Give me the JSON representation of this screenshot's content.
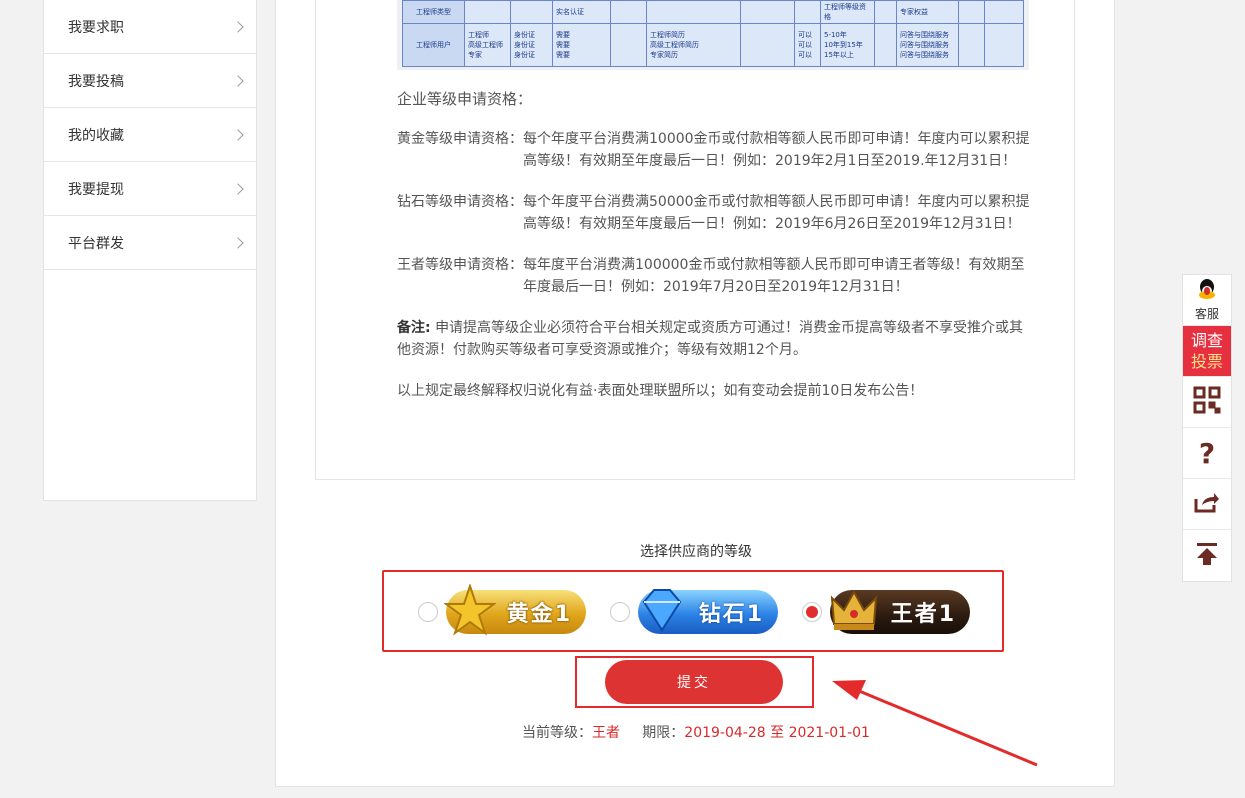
{
  "sidebar": {
    "items": [
      {
        "label": "我要求职"
      },
      {
        "label": "我要投稿"
      },
      {
        "label": "我的收藏"
      },
      {
        "label": "我要提现"
      },
      {
        "label": "平台群发"
      }
    ]
  },
  "table": {
    "row1": {
      "c1": "工程师类型",
      "c4": "实名认证",
      "c9": "工程师等级资格",
      "c11": "专家权益"
    },
    "row2": {
      "c1": "工程师用户",
      "c2": [
        "工程师",
        "高级工程师",
        "专家"
      ],
      "c3": [
        "身份证",
        "身份证",
        "身份证"
      ],
      "c4": [
        "需要",
        "需要",
        "需要"
      ],
      "c6": [
        "工程师简历",
        "高级工程师简历",
        "专家简历"
      ],
      "c8": [
        "可以",
        "可以",
        "可以"
      ],
      "c9": [
        "5-10年",
        "10年到15年",
        "15年以上"
      ],
      "c11": [
        "问答与围绕服务",
        "问答与围绕服务",
        "问答与围绕服务"
      ]
    }
  },
  "rules": {
    "heading": "企业等级申请资格：",
    "gold_key": "黄金等级申请资格：",
    "gold_val": "每个年度平台消费满10000金币或付款相等额人民币即可申请！年度内可以累积提高等级！有效期至年度最后一日！例如：2019年2月1日至2019.年12月31日！",
    "diamond_key": "钻石等级申请资格：",
    "diamond_val": "每个年度平台消费满50000金币或付款相等额人民币即可申请！年度内可以累积提高等级！有效期至年度最后一日！例如：2019年6月26日至2019年12月31日！",
    "king_key": "王者等级申请资格：",
    "king_val": "每年度平台消费满100000金币或付款相等额人民币即可申请王者等级！有效期至年度最后一日！例如：2019年7月20日至2019年12月31日！",
    "note_key": "备注:",
    "note_val": "申请提高等级企业必须符合平台相关规定或资质方可通过！消费金币提高等级者不享受推介或其他资源！付款购买等级者可享受资源或推介；等级有效期12个月。",
    "final": "以上规定最终解释权归说化有益·表面处理联盟所以；如有变动会提前10日发布公告！"
  },
  "grade_select": {
    "title": "选择供应商的等级",
    "options": [
      {
        "label": "黄金1",
        "selected": false,
        "icon": "star-icon"
      },
      {
        "label": "钻石1",
        "selected": false,
        "icon": "diamond-icon"
      },
      {
        "label": "王者1",
        "selected": true,
        "icon": "crown-icon"
      }
    ]
  },
  "submit_label": "提交",
  "current": {
    "level_label": "当前等级：",
    "level_value": "王者",
    "period_label": "期限：",
    "start": "2019-04-28",
    "to": "至",
    "end": "2021-01-01"
  },
  "float_bar": {
    "service": "客服",
    "survey_line1": "调查",
    "survey_line2": "投票",
    "help": "?"
  },
  "colors": {
    "accent": "#de3333",
    "highlight_box": "#e42b2b",
    "survey_bg": "#e62f3f"
  }
}
